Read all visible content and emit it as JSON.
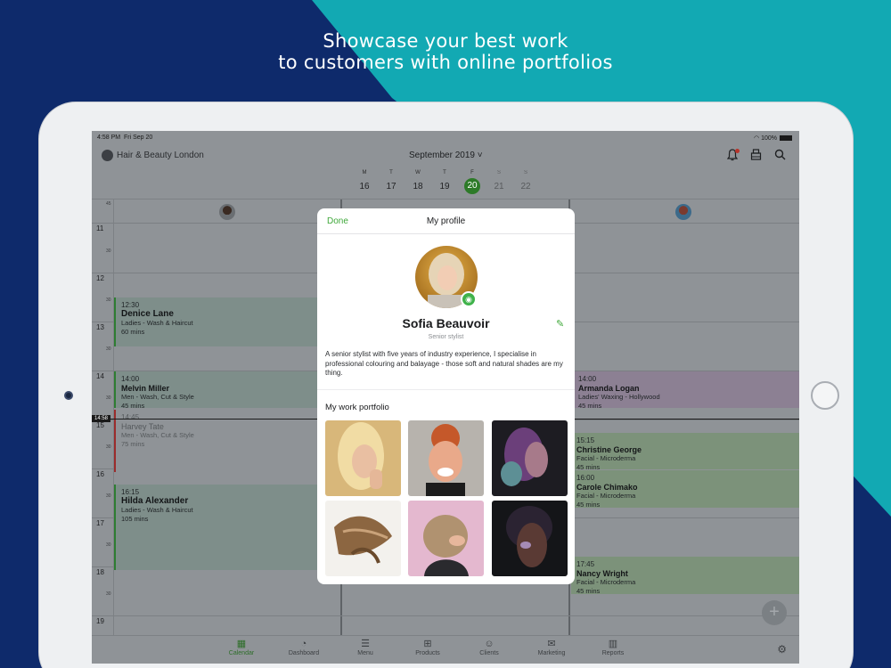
{
  "headline": {
    "line1": "Showcase your best work",
    "line2": "to customers with online portfolios"
  },
  "status_bar": {
    "time": "4:58 PM",
    "date": "Fri Sep 20",
    "battery": "100%"
  },
  "app_bar": {
    "salon_name": "Hair & Beauty London",
    "month": "September 2019 ˅"
  },
  "week": [
    {
      "dow": "M",
      "num": "16"
    },
    {
      "dow": "T",
      "num": "17"
    },
    {
      "dow": "W",
      "num": "18"
    },
    {
      "dow": "T",
      "num": "19"
    },
    {
      "dow": "F",
      "num": "20",
      "selected": true
    },
    {
      "dow": "S",
      "num": "21",
      "off": true
    },
    {
      "dow": "S",
      "num": "22",
      "off": true
    }
  ],
  "hours": [
    "11",
    "12",
    "13",
    "14",
    "15",
    "16",
    "17",
    "18",
    "19"
  ],
  "quarter_labels": [
    "15",
    "30",
    "45"
  ],
  "now_marker": "14:58",
  "appointments": {
    "denice": {
      "time": "12:30",
      "name": "Denice Lane",
      "service": "Ladies - Wash & Haircut",
      "duration": "60 mins"
    },
    "melvin": {
      "time": "14:00",
      "name": "Melvin Miller",
      "service": "Men - Wash, Cut & Style",
      "duration": "45 mins"
    },
    "harvey": {
      "time": "14:45",
      "name": "Harvey Tate",
      "service": "Men - Wash, Cut & Style",
      "duration": "75 mins"
    },
    "hilda": {
      "time": "16:15",
      "name": "Hilda Alexander",
      "service": "Ladies - Wash & Haircut",
      "duration": "105 mins"
    },
    "armanda": {
      "time": "14:00",
      "name": "Armanda Logan",
      "service": "Ladies' Waxing - Hollywood",
      "duration": "45 mins"
    },
    "christine": {
      "time": "15:15",
      "name": "Christine George",
      "service": "Facial - Microderma",
      "duration": "45 mins"
    },
    "carole": {
      "time": "16:00",
      "name": "Carole Chimako",
      "service": "Facial - Microderma",
      "duration": "45 mins"
    },
    "nancy": {
      "time": "17:45",
      "name": "Nancy Wright",
      "service": "Facial - Microderma",
      "duration": "45 mins"
    }
  },
  "tabs": [
    {
      "label": "Calendar",
      "icon": "calendar-icon",
      "glyph": "▦"
    },
    {
      "label": "Dashboard",
      "icon": "dashboard-icon",
      "glyph": "◔"
    },
    {
      "label": "Menu",
      "icon": "menu-icon",
      "glyph": "☰"
    },
    {
      "label": "Products",
      "icon": "products-icon",
      "glyph": "⊞"
    },
    {
      "label": "Clients",
      "icon": "clients-icon",
      "glyph": "☺"
    },
    {
      "label": "Marketing",
      "icon": "marketing-icon",
      "glyph": "✉"
    },
    {
      "label": "Reports",
      "icon": "reports-icon",
      "glyph": "▥"
    }
  ],
  "modal": {
    "done_label": "Done",
    "title": "My profile",
    "name": "Sofia Beauvoir",
    "role": "Senior stylist",
    "bio": "A senior stylist with five years of industry experience, I specialise in professional colouring and balayage - those soft and natural shades are my thing.",
    "portfolio_title": "My work portfolio"
  },
  "colors": {
    "accent_green": "#3fa83a",
    "navy": "#0e2a6b",
    "teal": "#12a9b3"
  }
}
